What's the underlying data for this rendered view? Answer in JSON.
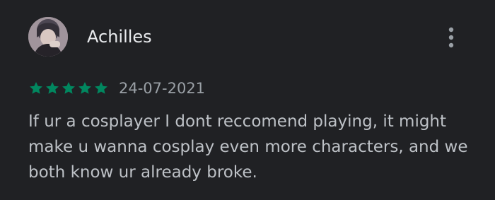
{
  "review": {
    "reviewer": {
      "name": "Achilles",
      "avatar_icon": "user-avatar-photo"
    },
    "menu": {
      "icon": "more-vertical-icon"
    },
    "rating": {
      "stars_filled": 5,
      "stars_total": 5,
      "star_icon": "star-icon",
      "star_color": "#01875f"
    },
    "date": "24-07-2021",
    "text": "If ur a cosplayer I dont reccomend playing, it might make u wanna cosplay even more characters, and we both know ur already broke."
  },
  "theme": {
    "background": "#202124",
    "name_color": "#e8eaed",
    "text_color": "#bdc1c6",
    "date_color": "#9aa0a6"
  }
}
